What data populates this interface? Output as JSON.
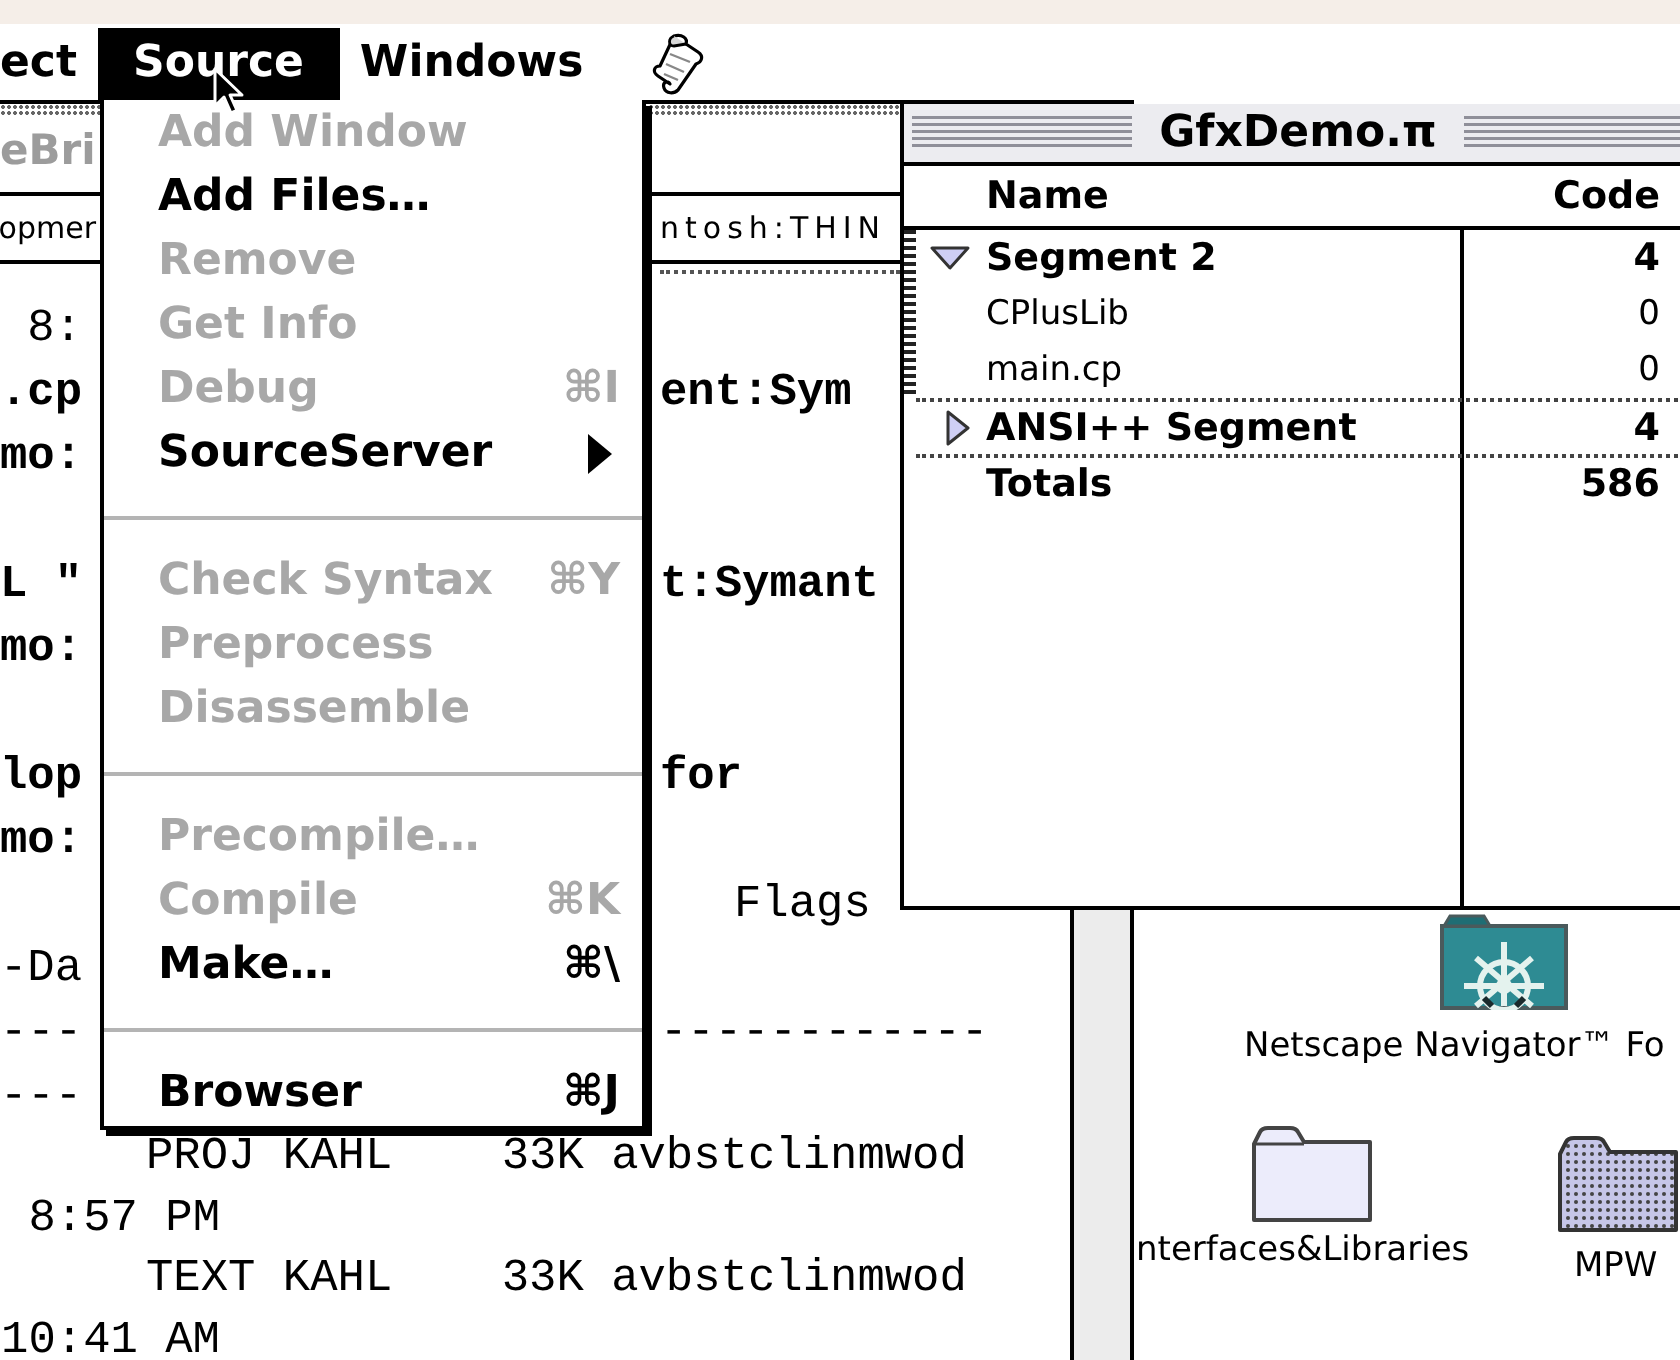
{
  "menu_bar": {
    "items": [
      {
        "label": "ect",
        "selected": false
      },
      {
        "label": "Source",
        "selected": true
      },
      {
        "label": "Windows",
        "selected": false
      }
    ]
  },
  "source_menu": {
    "items": [
      {
        "kind": "item",
        "label": "Add Window",
        "disabled": true
      },
      {
        "kind": "item",
        "label": "Add Files…",
        "disabled": false
      },
      {
        "kind": "item",
        "label": "Remove",
        "disabled": true
      },
      {
        "kind": "item",
        "label": "Get Info",
        "disabled": true
      },
      {
        "kind": "item",
        "label": "Debug",
        "shortcut": "⌘I",
        "disabled": true
      },
      {
        "kind": "submenu",
        "label": "SourceServer",
        "disabled": false
      },
      {
        "kind": "separator"
      },
      {
        "kind": "item",
        "label": "Check Syntax",
        "shortcut": "⌘Y",
        "disabled": true
      },
      {
        "kind": "item",
        "label": "Preprocess",
        "disabled": true
      },
      {
        "kind": "item",
        "label": "Disassemble",
        "disabled": true
      },
      {
        "kind": "separator"
      },
      {
        "kind": "item",
        "label": "Precompile…",
        "disabled": true
      },
      {
        "kind": "item",
        "label": "Compile",
        "shortcut": "⌘K",
        "disabled": true
      },
      {
        "kind": "item",
        "label": "Make…",
        "shortcut": "⌘\\",
        "disabled": false
      },
      {
        "kind": "separator"
      },
      {
        "kind": "item",
        "label": "Browser",
        "shortcut": "⌘J",
        "disabled": false
      }
    ]
  },
  "text_window": {
    "title": "eBri",
    "path_bar": {
      "left": "opmer",
      "right": "ntosh:THIN"
    },
    "lines": [
      {
        "kind": "split",
        "left": "8:",
        "bold": false
      },
      {
        "kind": "split",
        "left": ".cp",
        "right": "ent:Sym",
        "bold": true
      },
      {
        "kind": "split",
        "left": "mo:",
        "bold": true
      },
      {
        "kind": "blank"
      },
      {
        "kind": "split",
        "left": "L \"",
        "right": "t:Symant",
        "bold": true
      },
      {
        "kind": "split",
        "left": "mo:",
        "bold": true
      },
      {
        "kind": "blank"
      },
      {
        "kind": "split",
        "left": "lop",
        "right": "for",
        "bold": true
      },
      {
        "kind": "split",
        "left": "mo:",
        "bold": true
      },
      {
        "kind": "heading",
        "right": "Flags",
        "bold": false
      },
      {
        "kind": "split",
        "left": "-Da",
        "bold": false
      },
      {
        "kind": "split",
        "left": "---",
        "right": "------------",
        "bold": false
      },
      {
        "kind": "split",
        "left": "---",
        "bold": false
      },
      {
        "kind": "record",
        "text": "PROJ KAHL    33K avbstclinmwod",
        "bold": false
      },
      {
        "kind": "time",
        "text": "8:57 PM",
        "bold": false
      },
      {
        "kind": "record",
        "text": "TEXT KAHL    33K avbstclinmwod",
        "bold": false
      },
      {
        "kind": "time",
        "text": "10:41 AM",
        "bold": false
      }
    ]
  },
  "project_window": {
    "title": "GfxDemo.π",
    "columns": [
      "Name",
      "Code"
    ],
    "segments": [
      {
        "name": "Segment 2",
        "code": "4",
        "expanded": true,
        "children": [
          {
            "name": "CPlusLib",
            "code": "0"
          },
          {
            "name": "main.cp",
            "code": "0"
          }
        ]
      },
      {
        "name": "ANSI++ Segment",
        "code": "4",
        "expanded": false
      }
    ],
    "totals": {
      "label": "Totals",
      "code": "586"
    }
  },
  "finder_window": {
    "icons": [
      {
        "kind": "wheel",
        "label": "Netscape Navigator™ Fo"
      },
      {
        "kind": "plain",
        "label": "nterfaces&Libraries"
      },
      {
        "kind": "dotted",
        "label": "MPW"
      }
    ]
  }
}
